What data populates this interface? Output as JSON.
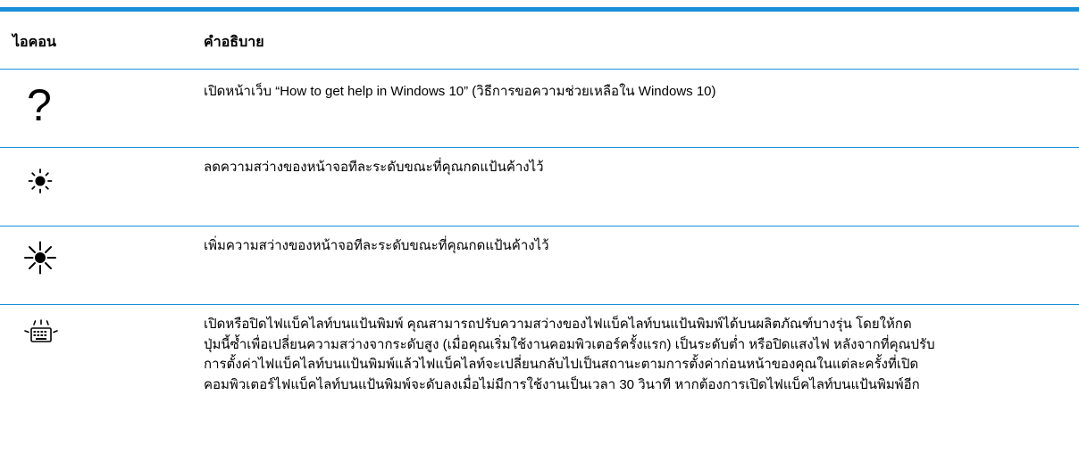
{
  "table": {
    "header_icon": "ไอคอน",
    "header_description": "คำอธิบาย",
    "rows": [
      {
        "icon": "question-mark-icon",
        "icon_glyph": "?",
        "description": "เปิดหน้าเว็บ “How to get help in Windows 10” (วิธีการขอความช่วยเหลือใน Windows 10)"
      },
      {
        "icon": "brightness-down-icon",
        "description": "ลดความสว่างของหน้าจอทีละระดับขณะที่คุณกดแป้นค้างไว้"
      },
      {
        "icon": "brightness-up-icon",
        "description": "เพิ่มความสว่างของหน้าจอทีละระดับขณะที่คุณกดแป้นค้างไว้"
      },
      {
        "icon": "keyboard-backlight-icon",
        "description_lines": [
          "เปิดหรือปิดไฟแบ็คไลท์บนแป้นพิมพ์ คุณสามารถปรับความสว่างของไฟแบ็คไลท์บนแป้นพิมพ์ได้บนผลิตภัณฑ์บางรุ่น โดยให้กด",
          "ปุ่มนี้ซ้ำเพื่อเปลี่ยนความสว่างจากระดับสูง (เมื่อคุณเริ่มใช้งานคอมพิวเตอร์ครั้งแรก) เป็นระดับต่ำ หรือปิดแสงไฟ หลังจากที่คุณปรับ",
          "การตั้งค่าไฟแบ็คไลท์บนแป้นพิมพ์แล้วไฟแบ็คไลท์จะเปลี่ยนกลับไปเป็นสถานะตามการตั้งค่าก่อนหน้าของคุณในแต่ละครั้งที่เปิด",
          "คอมพิวเตอร์ไฟแบ็คไลท์บนแป้นพิมพ์จะดับลงเมื่อไม่มีการใช้งานเป็นเวลา 30 วินาที หากต้องการเปิดไฟแบ็คไลท์บนแป้นพิมพ์อีก"
        ]
      }
    ]
  },
  "colors": {
    "rule": "#1a8fd6",
    "text": "#000000"
  }
}
